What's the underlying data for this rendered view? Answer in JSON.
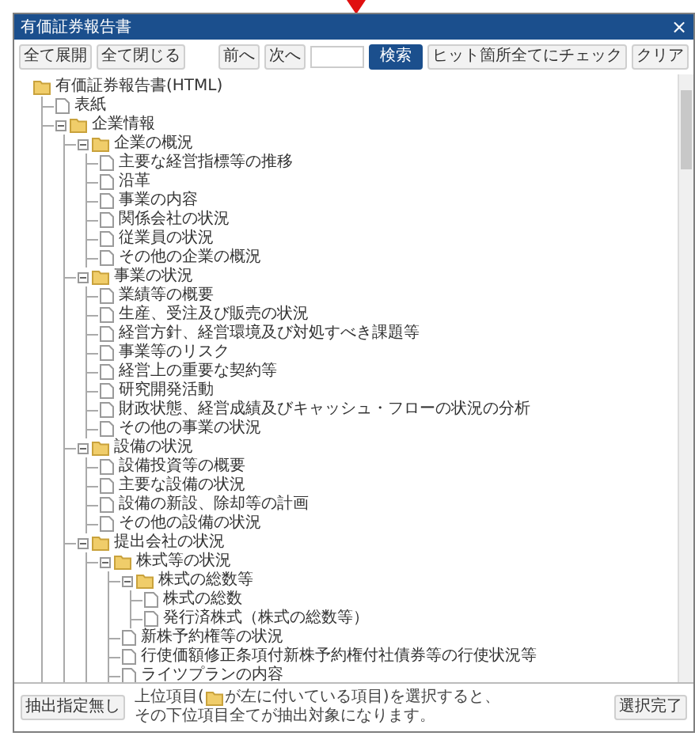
{
  "window": {
    "title": "有価証券報告書",
    "close": "×"
  },
  "toolbar": {
    "expand_buttons": [
      "全て展開",
      "全て閉じる"
    ],
    "nav_buttons": [
      "前へ",
      "次へ"
    ],
    "search_button": "検索",
    "action_buttons": [
      "ヒット箇所全てにチェック",
      "クリア"
    ]
  },
  "tree": {
    "label": "有価証券報告書(HTML)",
    "kind": "folder",
    "children": [
      {
        "label": "表紙",
        "kind": "page"
      },
      {
        "label": "企業情報",
        "kind": "folder",
        "expanded": true,
        "children": [
          {
            "label": "企業の概況",
            "kind": "folder",
            "expanded": true,
            "children": [
              {
                "label": "主要な経営指標等の推移",
                "kind": "page"
              },
              {
                "label": "沿革",
                "kind": "page"
              },
              {
                "label": "事業の内容",
                "kind": "page"
              },
              {
                "label": "関係会社の状況",
                "kind": "page"
              },
              {
                "label": "従業員の状況",
                "kind": "page"
              },
              {
                "label": "その他の企業の概況",
                "kind": "page"
              }
            ]
          },
          {
            "label": "事業の状況",
            "kind": "folder",
            "expanded": true,
            "children": [
              {
                "label": "業績等の概要",
                "kind": "page"
              },
              {
                "label": "生産、受注及び販売の状況",
                "kind": "page"
              },
              {
                "label": "経営方針、経営環境及び対処すべき課題等",
                "kind": "page"
              },
              {
                "label": "事業等のリスク",
                "kind": "page"
              },
              {
                "label": "経営上の重要な契約等",
                "kind": "page"
              },
              {
                "label": "研究開発活動",
                "kind": "page"
              },
              {
                "label": "財政状態、経営成績及びキャッシュ・フローの状況の分析",
                "kind": "page"
              },
              {
                "label": "その他の事業の状況",
                "kind": "page"
              }
            ]
          },
          {
            "label": "設備の状況",
            "kind": "folder",
            "expanded": true,
            "children": [
              {
                "label": "設備投資等の概要",
                "kind": "page"
              },
              {
                "label": "主要な設備の状況",
                "kind": "page"
              },
              {
                "label": "設備の新設、除却等の計画",
                "kind": "page"
              },
              {
                "label": "その他の設備の状況",
                "kind": "page"
              }
            ]
          },
          {
            "label": "提出会社の状況",
            "kind": "folder",
            "expanded": true,
            "children": [
              {
                "label": "株式等の状況",
                "kind": "folder",
                "expanded": true,
                "children": [
                  {
                    "label": "株式の総数等",
                    "kind": "folder",
                    "expanded": true,
                    "children": [
                      {
                        "label": "株式の総数",
                        "kind": "page"
                      },
                      {
                        "label": "発行済株式（株式の総数等）",
                        "kind": "page"
                      }
                    ]
                  },
                  {
                    "label": "新株予約権等の状況",
                    "kind": "page"
                  },
                  {
                    "label": "行使価額修正条項付新株予約権付社債券等の行使状況等",
                    "kind": "page"
                  },
                  {
                    "label": "ライツプランの内容",
                    "kind": "page"
                  }
                ]
              }
            ]
          }
        ]
      }
    ]
  },
  "footer": {
    "left_button": "抽出指定無し",
    "hint_before": "上位項目(",
    "hint_middle": "が左に付いている項目)を選択すると、",
    "hint_end": "その下位項目全てが抽出対象になります。",
    "right_button": "選択完了"
  }
}
